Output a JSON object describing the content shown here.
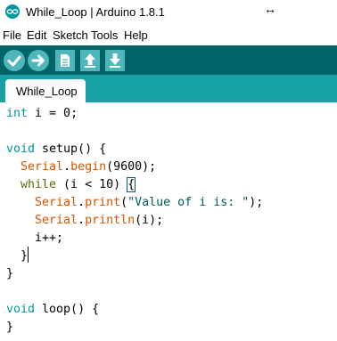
{
  "window": {
    "title": "While_Loop | Arduino 1.8.1"
  },
  "menu": [
    "File",
    "Edit",
    "Sketch",
    "Tools",
    "Help"
  ],
  "toolbar": {
    "buttons": [
      "verify-icon",
      "upload-icon",
      "new-icon",
      "open-icon",
      "save-icon"
    ]
  },
  "tabs": [
    {
      "label": "While_Loop"
    }
  ],
  "editor": {
    "lines": [
      "int i = 0;",
      "",
      "void setup() {",
      "  Serial.begin(9600);",
      "  while (i < 10) {",
      "    Serial.print(\"Value of i is: \");",
      "    Serial.println(i);",
      "    i++;",
      "  }",
      "}",
      "",
      "void loop() {",
      "}"
    ]
  },
  "colors": {
    "toolbar": "#006468",
    "tabstrip": "#17a1a5",
    "button": "#4db7bb",
    "keyword_type": "#00979c",
    "keyword_control": "#5e6d03",
    "library_function": "#d35400",
    "string": "#005c5f"
  }
}
